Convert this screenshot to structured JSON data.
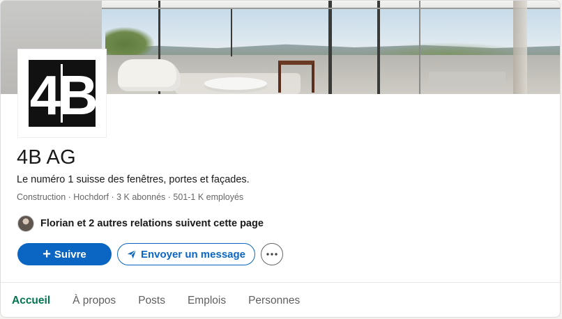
{
  "company": {
    "name": "4B AG",
    "logo_text": "4B",
    "tagline": "Le numéro 1 suisse des fenêtres, portes et façades.",
    "meta": "Construction · Hochdorf · 3 K abonnés · 501-1 K employés",
    "followers_text": "Florian et 2 autres relations suivent cette page"
  },
  "actions": {
    "follow_label": "Suivre",
    "follow_icon": "plus-icon",
    "message_label": "Envoyer un message",
    "message_icon": "send-icon",
    "more_icon": "more-horizontal-icon"
  },
  "tabs": [
    {
      "label": "Accueil",
      "active": true
    },
    {
      "label": "À propos",
      "active": false
    },
    {
      "label": "Posts",
      "active": false
    },
    {
      "label": "Emplois",
      "active": false
    },
    {
      "label": "Personnes",
      "active": false
    }
  ],
  "colors": {
    "primary": "#0a66c2",
    "active_tab": "#01754f",
    "text": "#191919",
    "muted": "#666666"
  }
}
